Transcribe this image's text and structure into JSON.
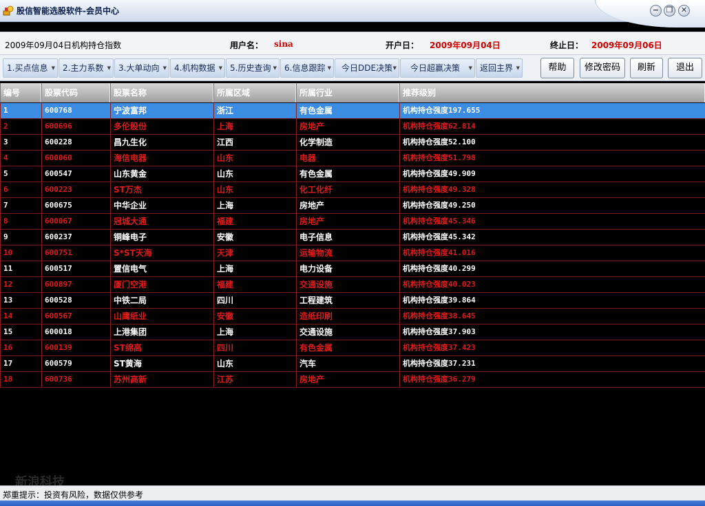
{
  "window": {
    "title": "股信智能选股软件-会员中心",
    "controls": [
      "−",
      "❐",
      "✕"
    ]
  },
  "info": {
    "report_title": "2009年09月04日机构持仓指数",
    "username_label": "用户名：",
    "username": "sina",
    "start_label": "开户日：",
    "start_date": "2009年09月04日",
    "end_label": "终止日：",
    "end_date": "2009年09月06日"
  },
  "toolbar": {
    "menus": [
      {
        "label": "1.买点信息"
      },
      {
        "label": "2.主力系数"
      },
      {
        "label": "3.大单动向"
      },
      {
        "label": "4.机构数据"
      },
      {
        "label": "5.历史查询"
      },
      {
        "label": "6.信息跟踪"
      },
      {
        "label": "今日DDE决策"
      },
      {
        "label": "今日超赢决策"
      },
      {
        "label": "返回主界"
      }
    ],
    "buttons": [
      {
        "label": "帮助"
      },
      {
        "label": "修改密码"
      },
      {
        "label": "刷新"
      },
      {
        "label": "退出"
      }
    ]
  },
  "table": {
    "headers": [
      "编号",
      "股票代码",
      "股票名称",
      "所属区域",
      "所属行业",
      "推荐级别"
    ],
    "rows": [
      [
        "1",
        "600768",
        "宁波富邦",
        "浙江",
        "有色金属",
        "机构持仓强度197.655"
      ],
      [
        "2",
        "600696",
        "多伦股份",
        "上海",
        "房地产",
        "机构持仓强度62.814"
      ],
      [
        "3",
        "600228",
        "昌九生化",
        "江西",
        "化学制造",
        "机构持仓强度52.100"
      ],
      [
        "4",
        "600060",
        "海信电器",
        "山东",
        "电器",
        "机构持仓强度51.798"
      ],
      [
        "5",
        "600547",
        "山东黄金",
        "山东",
        "有色金属",
        "机构持仓强度49.909"
      ],
      [
        "6",
        "600223",
        "ST万杰",
        "山东",
        "化工化纤",
        "机构持仓强度49.328"
      ],
      [
        "7",
        "600675",
        "中华企业",
        "上海",
        "房地产",
        "机构持仓强度49.250"
      ],
      [
        "8",
        "600067",
        "冠城大通",
        "福建",
        "房地产",
        "机构持仓强度45.346"
      ],
      [
        "9",
        "600237",
        "铜峰电子",
        "安徽",
        "电子信息",
        "机构持仓强度45.342"
      ],
      [
        "10",
        "600751",
        "S*ST天海",
        "天津",
        "运输物流",
        "机构持仓强度41.016"
      ],
      [
        "11",
        "600517",
        "置信电气",
        "上海",
        "电力设备",
        "机构持仓强度40.299"
      ],
      [
        "12",
        "600897",
        "厦门空港",
        "福建",
        "交通设施",
        "机构持仓强度40.023"
      ],
      [
        "13",
        "600528",
        "中铁二局",
        "四川",
        "工程建筑",
        "机构持仓强度39.864"
      ],
      [
        "14",
        "600567",
        "山鹰纸业",
        "安徽",
        "造纸印刷",
        "机构持仓强度38.645"
      ],
      [
        "15",
        "600018",
        "上港集团",
        "上海",
        "交通设施",
        "机构持仓强度37.903"
      ],
      [
        "16",
        "600139",
        "ST绵高",
        "四川",
        "有色金属",
        "机构持仓强度37.423"
      ],
      [
        "17",
        "600579",
        "ST黄海",
        "山东",
        "汽车",
        "机构持仓强度37.231"
      ],
      [
        "18",
        "600736",
        "苏州高新",
        "江苏",
        "房地产",
        "机构持仓强度36.279"
      ]
    ]
  },
  "status": {
    "text": "郑重提示：投资有风险，数据仅供参考"
  },
  "watermark": "新浪科技",
  "colors": {
    "even_row_text": "#e11a1a",
    "odd_row_text": "#ffffff",
    "selected_row": "#3b8de4",
    "info_value": "#d10000"
  }
}
